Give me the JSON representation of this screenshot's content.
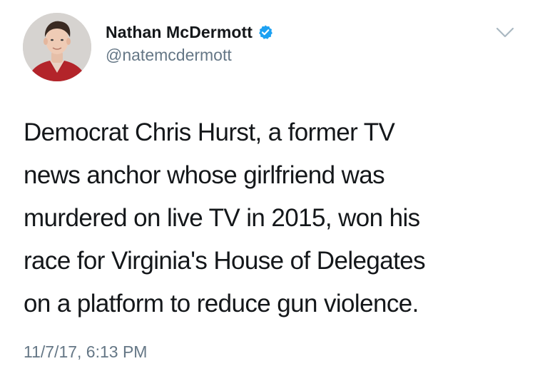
{
  "author": {
    "display_name": "Nathan McDermott",
    "handle": "@natemcdermott",
    "verified": true
  },
  "tweet": {
    "text_lines": [
      "Democrat Chris Hurst, a former TV",
      "news anchor whose girlfriend was",
      "murdered on live TV in 2015, won his",
      "race for Virginia's House of Delegates",
      "on a platform to reduce gun violence."
    ],
    "timestamp": "11/7/17, 6:13 PM"
  },
  "icons": {
    "verified": "verified-badge-icon",
    "menu": "chevron-down-icon"
  },
  "colors": {
    "text_primary": "#14171a",
    "text_secondary": "#657786",
    "verified_blue": "#1da1f2",
    "chevron_gray": "#aab8c2"
  }
}
